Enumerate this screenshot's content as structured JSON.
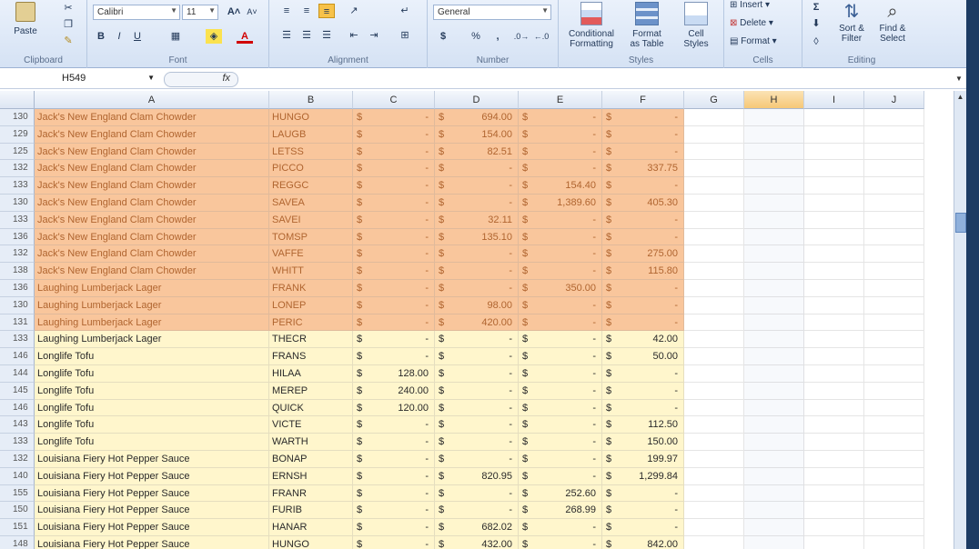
{
  "ribbon": {
    "clipboard": {
      "paste_label": "Paste",
      "group_label": "Clipboard"
    },
    "font": {
      "font_name": "Calibri",
      "font_size": "11",
      "bold": "B",
      "italic": "I",
      "underline": "U",
      "group_label": "Font"
    },
    "alignment": {
      "group_label": "Alignment"
    },
    "number": {
      "format": "General",
      "currency": "$",
      "percent": "%",
      "comma": ",",
      "group_label": "Number"
    },
    "styles": {
      "conditional_line1": "Conditional",
      "conditional_line2": "Formatting",
      "format_table_line1": "Format",
      "format_table_line2": "as Table",
      "cell_styles_line1": "Cell",
      "cell_styles_line2": "Styles",
      "group_label": "Styles"
    },
    "cells": {
      "insert": "Insert",
      "delete": "Delete",
      "format": "Format",
      "group_label": "Cells"
    },
    "editing": {
      "sigma": "Σ",
      "sort_line1": "Sort &",
      "sort_line2": "Filter",
      "find_line1": "Find &",
      "find_line2": "Select",
      "group_label": "Editing"
    }
  },
  "formula_bar": {
    "name_box": "H549",
    "fx": "fx"
  },
  "columns": [
    "A",
    "B",
    "C",
    "D",
    "E",
    "F",
    "G",
    "H",
    "I",
    "J"
  ],
  "selected_column": "H",
  "rows": [
    {
      "num": "130",
      "product": "Jack's New England Clam Chowder",
      "customer": "HUNGO",
      "c": "-",
      "d": "694.00",
      "e": "-",
      "f": "-",
      "style": "orange"
    },
    {
      "num": "129",
      "product": "Jack's New England Clam Chowder",
      "customer": "LAUGB",
      "c": "-",
      "d": "154.00",
      "e": "-",
      "f": "-",
      "style": "orange"
    },
    {
      "num": "125",
      "product": "Jack's New England Clam Chowder",
      "customer": "LETSS",
      "c": "-",
      "d": "82.51",
      "e": "-",
      "f": "-",
      "style": "orange"
    },
    {
      "num": "132",
      "product": "Jack's New England Clam Chowder",
      "customer": "PICCO",
      "c": "-",
      "d": "-",
      "e": "-",
      "f": "337.75",
      "style": "orange"
    },
    {
      "num": "133",
      "product": "Jack's New England Clam Chowder",
      "customer": "REGGC",
      "c": "-",
      "d": "-",
      "e": "154.40",
      "f": "-",
      "style": "orange"
    },
    {
      "num": "130",
      "product": "Jack's New England Clam Chowder",
      "customer": "SAVEA",
      "c": "-",
      "d": "-",
      "e": "1,389.60",
      "f": "405.30",
      "style": "orange"
    },
    {
      "num": "133",
      "product": "Jack's New England Clam Chowder",
      "customer": "SAVEI",
      "c": "-",
      "d": "32.11",
      "e": "-",
      "f": "-",
      "style": "orange"
    },
    {
      "num": "136",
      "product": "Jack's New England Clam Chowder",
      "customer": "TOMSP",
      "c": "-",
      "d": "135.10",
      "e": "-",
      "f": "-",
      "style": "orange"
    },
    {
      "num": "132",
      "product": "Jack's New England Clam Chowder",
      "customer": "VAFFE",
      "c": "-",
      "d": "-",
      "e": "-",
      "f": "275.00",
      "style": "orange"
    },
    {
      "num": "138",
      "product": "Jack's New England Clam Chowder",
      "customer": "WHITT",
      "c": "-",
      "d": "-",
      "e": "-",
      "f": "115.80",
      "style": "orange"
    },
    {
      "num": "136",
      "product": "Laughing Lumberjack Lager",
      "customer": "FRANK",
      "c": "-",
      "d": "-",
      "e": "350.00",
      "f": "-",
      "style": "orange"
    },
    {
      "num": "130",
      "product": "Laughing Lumberjack Lager",
      "customer": "LONEP",
      "c": "-",
      "d": "98.00",
      "e": "-",
      "f": "-",
      "style": "orange"
    },
    {
      "num": "131",
      "product": "Laughing Lumberjack Lager",
      "customer": "PERIC",
      "c": "-",
      "d": "420.00",
      "e": "-",
      "f": "-",
      "style": "orange"
    },
    {
      "num": "133",
      "product": "Laughing Lumberjack Lager",
      "customer": "THECR",
      "c": "-",
      "d": "-",
      "e": "-",
      "f": "42.00",
      "style": "yellow"
    },
    {
      "num": "146",
      "product": "Longlife Tofu",
      "customer": "FRANS",
      "c": "-",
      "d": "-",
      "e": "-",
      "f": "50.00",
      "style": "yellow"
    },
    {
      "num": "144",
      "product": "Longlife Tofu",
      "customer": "HILAA",
      "c": "128.00",
      "d": "-",
      "e": "-",
      "f": "-",
      "style": "yellow"
    },
    {
      "num": "145",
      "product": "Longlife Tofu",
      "customer": "MEREP",
      "c": "240.00",
      "d": "-",
      "e": "-",
      "f": "-",
      "style": "yellow"
    },
    {
      "num": "146",
      "product": "Longlife Tofu",
      "customer": "QUICK",
      "c": "120.00",
      "d": "-",
      "e": "-",
      "f": "-",
      "style": "yellow"
    },
    {
      "num": "143",
      "product": "Longlife Tofu",
      "customer": "VICTE",
      "c": "-",
      "d": "-",
      "e": "-",
      "f": "112.50",
      "style": "yellow"
    },
    {
      "num": "133",
      "product": "Longlife Tofu",
      "customer": "WARTH",
      "c": "-",
      "d": "-",
      "e": "-",
      "f": "150.00",
      "style": "yellow"
    },
    {
      "num": "132",
      "product": "Louisiana Fiery Hot Pepper Sauce",
      "customer": "BONAP",
      "c": "-",
      "d": "-",
      "e": "-",
      "f": "199.97",
      "style": "yellow"
    },
    {
      "num": "140",
      "product": "Louisiana Fiery Hot Pepper Sauce",
      "customer": "ERNSH",
      "c": "-",
      "d": "820.95",
      "e": "-",
      "f": "1,299.84",
      "style": "yellow"
    },
    {
      "num": "155",
      "product": "Louisiana Fiery Hot Pepper Sauce",
      "customer": "FRANR",
      "c": "-",
      "d": "-",
      "e": "252.60",
      "f": "-",
      "style": "yellow"
    },
    {
      "num": "150",
      "product": "Louisiana Fiery Hot Pepper Sauce",
      "customer": "FURIB",
      "c": "-",
      "d": "-",
      "e": "268.99",
      "f": "-",
      "style": "yellow"
    },
    {
      "num": "151",
      "product": "Louisiana Fiery Hot Pepper Sauce",
      "customer": "HANAR",
      "c": "-",
      "d": "682.02",
      "e": "-",
      "f": "-",
      "style": "yellow"
    },
    {
      "num": "148",
      "product": "Louisiana Fiery Hot Pepper Sauce",
      "customer": "HUNGO",
      "c": "-",
      "d": "432.00",
      "e": "-",
      "f": "842.00",
      "style": "yellow"
    }
  ],
  "currency_symbol": "$"
}
